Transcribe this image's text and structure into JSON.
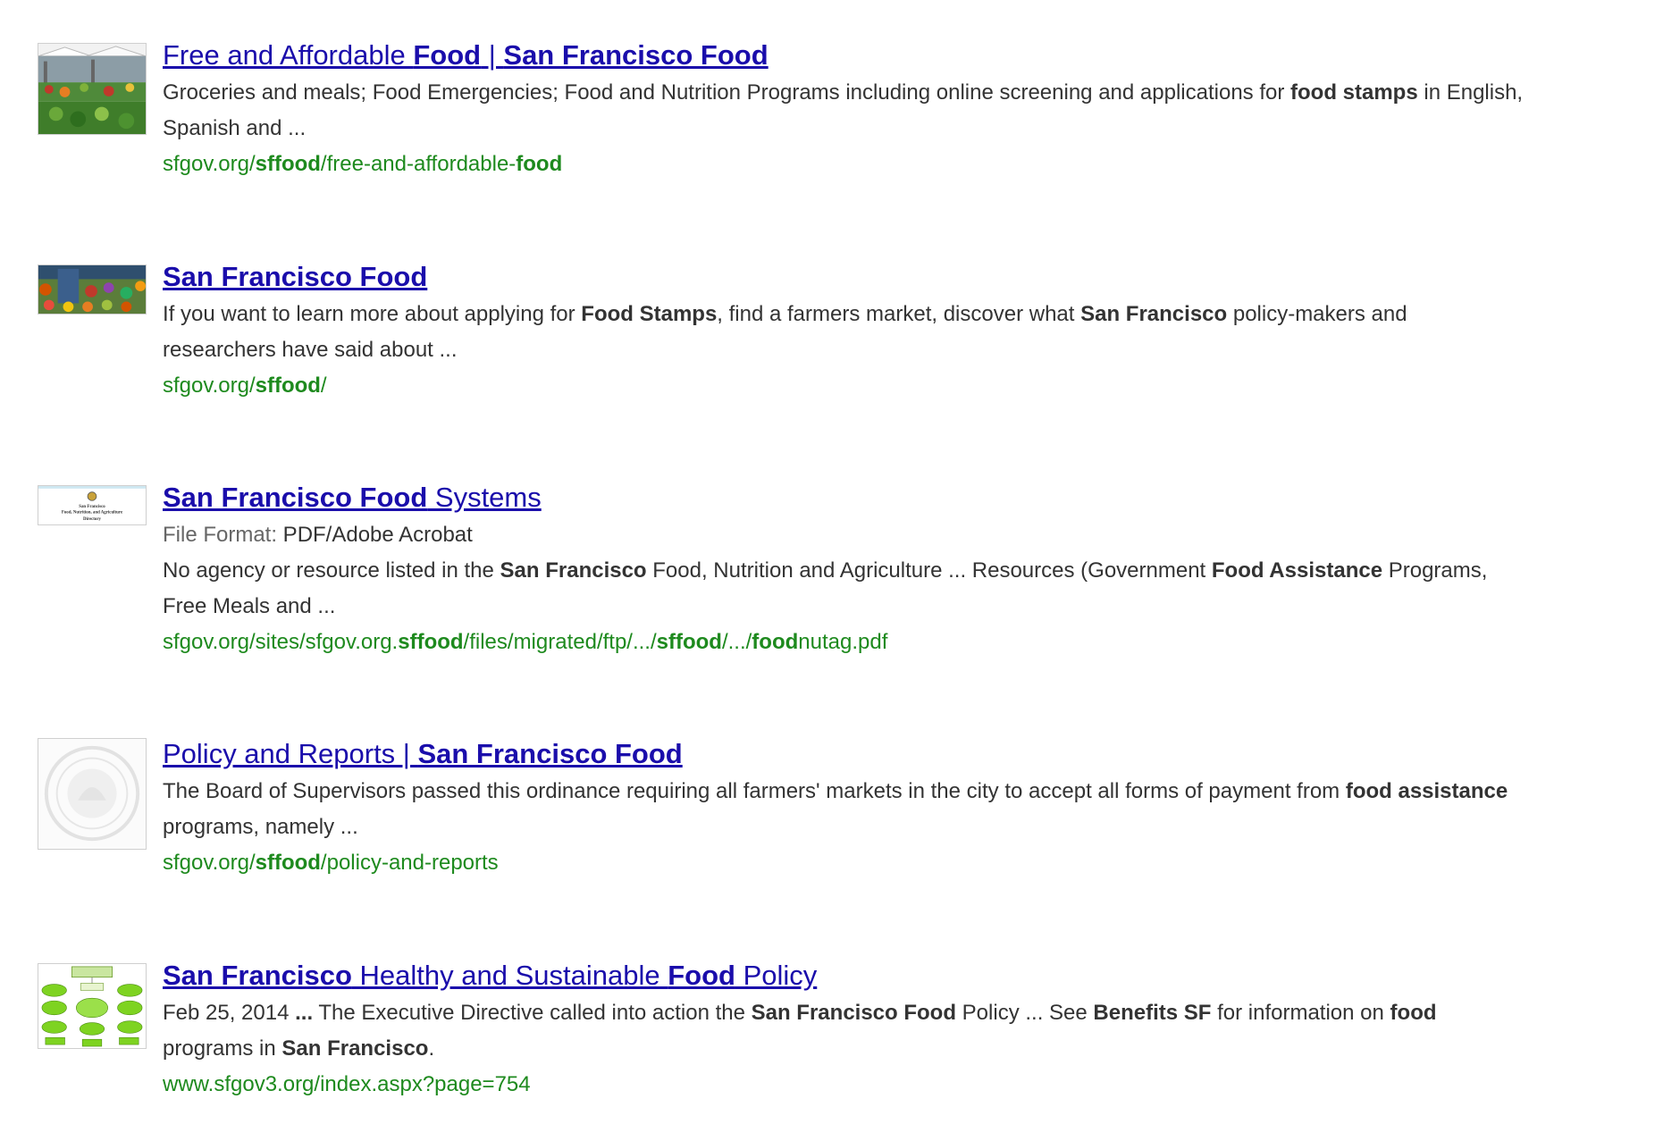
{
  "results": [
    {
      "thumbnail": "farmers-market-stalls-photo",
      "title": [
        {
          "t": "Free and Affordable ",
          "b": false
        },
        {
          "t": "Food",
          "b": true
        },
        {
          "t": " | ",
          "b": false
        },
        {
          "t": "San Francisco Food",
          "b": true
        }
      ],
      "meta": null,
      "snippet": [
        [
          {
            "t": "Groceries and meals; Food Emergencies; Food and Nutrition Programs including online screening and applications for ",
            "b": false
          },
          {
            "t": "food stamps",
            "b": true
          },
          {
            "t": " in English,",
            "b": false
          }
        ],
        [
          {
            "t": "Spanish and ...",
            "b": false
          }
        ]
      ],
      "url": [
        {
          "t": "sfgov.org/",
          "b": false
        },
        {
          "t": "sffood",
          "b": true
        },
        {
          "t": "/free-and-affordable-",
          "b": false
        },
        {
          "t": "food",
          "b": true
        }
      ]
    },
    {
      "thumbnail": "produce-stand-photo",
      "title": [
        {
          "t": "San Francisco Food",
          "b": true
        }
      ],
      "meta": null,
      "snippet": [
        [
          {
            "t": "If you want to learn more about applying for ",
            "b": false
          },
          {
            "t": "Food Stamps",
            "b": true
          },
          {
            "t": ", find a farmers market, discover what ",
            "b": false
          },
          {
            "t": "San Francisco",
            "b": true
          },
          {
            "t": " policy-makers and",
            "b": false
          }
        ],
        [
          {
            "t": "researchers have said about ...",
            "b": false
          }
        ]
      ],
      "url": [
        {
          "t": "sfgov.org/",
          "b": false
        },
        {
          "t": "sffood",
          "b": true
        },
        {
          "t": "/",
          "b": false
        }
      ]
    },
    {
      "thumbnail": "pdf-document-cover",
      "title": [
        {
          "t": "San Francisco Food",
          "b": true
        },
        {
          "t": " Systems",
          "b": false
        }
      ],
      "meta": {
        "label": "File Format:",
        "value": " PDF/Adobe Acrobat"
      },
      "snippet": [
        [
          {
            "t": "No agency or resource listed in the ",
            "b": false
          },
          {
            "t": "San Francisco",
            "b": true
          },
          {
            "t": " Food, Nutrition and Agriculture ... Resources (Government ",
            "b": false
          },
          {
            "t": "Food Assistance",
            "b": true
          },
          {
            "t": " Programs,",
            "b": false
          }
        ],
        [
          {
            "t": "Free Meals and ...",
            "b": false
          }
        ]
      ],
      "url": [
        {
          "t": "sfgov.org/sites/sfgov.org.",
          "b": false
        },
        {
          "t": "sffood",
          "b": true
        },
        {
          "t": "/files/migrated/ftp/.../",
          "b": false
        },
        {
          "t": "sffood",
          "b": true
        },
        {
          "t": "/.../",
          "b": false
        },
        {
          "t": "food",
          "b": true
        },
        {
          "t": "nutag.pdf",
          "b": false
        }
      ]
    },
    {
      "thumbnail": "city-seal-watermark",
      "title": [
        {
          "t": "Policy and Reports | ",
          "b": false
        },
        {
          "t": "San Francisco Food",
          "b": true
        }
      ],
      "meta": null,
      "snippet": [
        [
          {
            "t": "The Board of Supervisors passed this ordinance requiring all farmers' markets in the city to accept all forms of payment from ",
            "b": false
          },
          {
            "t": "food assistance",
            "b": true
          }
        ],
        [
          {
            "t": "programs, namely ...",
            "b": false
          }
        ]
      ],
      "url": [
        {
          "t": "sfgov.org/",
          "b": false
        },
        {
          "t": "sffood",
          "b": true
        },
        {
          "t": "/policy-and-reports",
          "b": false
        }
      ]
    },
    {
      "thumbnail": "policy-org-chart-diagram",
      "title": [
        {
          "t": "San Francisco",
          "b": true
        },
        {
          "t": " Healthy and Sustainable ",
          "b": false
        },
        {
          "t": "Food",
          "b": true
        },
        {
          "t": " Policy",
          "b": false
        }
      ],
      "meta": null,
      "snippet": [
        [
          {
            "t": "Feb 25, 2014 ",
            "b": false
          },
          {
            "t": "...",
            "b": true
          },
          {
            "t": " The Executive Directive called into action the ",
            "b": false
          },
          {
            "t": "San Francisco Food",
            "b": true
          },
          {
            "t": " Policy ... See ",
            "b": false
          },
          {
            "t": "Benefits SF",
            "b": true
          },
          {
            "t": " for information on ",
            "b": false
          },
          {
            "t": "food",
            "b": true
          }
        ],
        [
          {
            "t": "programs in ",
            "b": false
          },
          {
            "t": "San Francisco",
            "b": true
          },
          {
            "t": ".",
            "b": false
          }
        ]
      ],
      "url": [
        {
          "t": "www.sfgov3.org/index.aspx?page=754",
          "b": false
        }
      ]
    }
  ],
  "thumbnail_text": {
    "pdf_cover": [
      "San Francisco",
      "Food, Nutrition, and Agriculture",
      "Directory"
    ]
  },
  "colors": {
    "link": "#1a0dab",
    "url": "#1e8a1e",
    "text": "#333333",
    "meta_label": "#666666"
  }
}
